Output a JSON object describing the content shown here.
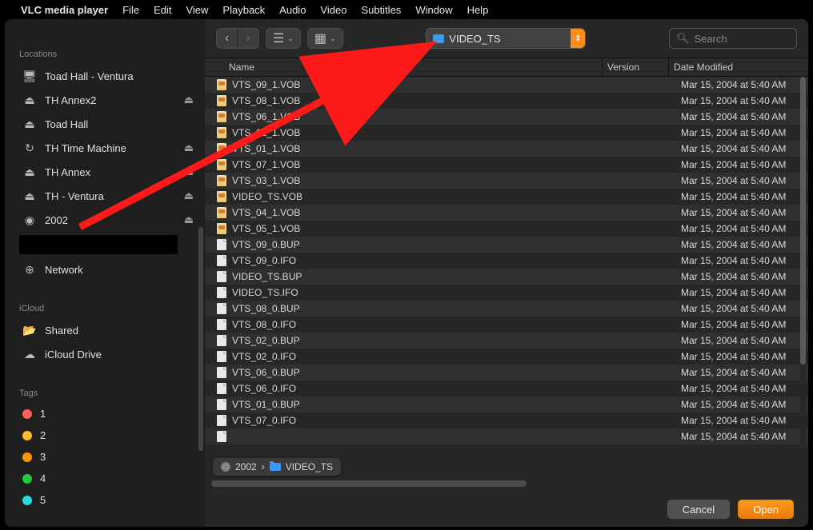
{
  "menubar": {
    "app_name": "VLC media player",
    "items": [
      "File",
      "Edit",
      "View",
      "Playback",
      "Audio",
      "Video",
      "Subtitles",
      "Window",
      "Help"
    ]
  },
  "sidebar": {
    "locations_label": "Locations",
    "icloud_label": "iCloud",
    "tags_label": "Tags",
    "locations": [
      {
        "label": "Toad Hall - Ventura",
        "icon": "display",
        "eject": false
      },
      {
        "label": "TH Annex2",
        "icon": "drive",
        "eject": true
      },
      {
        "label": "Toad Hall",
        "icon": "drive",
        "eject": false
      },
      {
        "label": "TH Time Machine",
        "icon": "timemachine",
        "eject": true
      },
      {
        "label": "TH Annex",
        "icon": "drive",
        "eject": true
      },
      {
        "label": "TH - Ventura",
        "icon": "drive",
        "eject": true
      },
      {
        "label": "2002",
        "icon": "disc",
        "eject": true
      },
      {
        "label": "",
        "icon": "",
        "eject": false,
        "redacted": true
      },
      {
        "label": "Network",
        "icon": "network",
        "eject": false
      }
    ],
    "icloud": [
      {
        "label": "Shared",
        "icon": "folder-shared"
      },
      {
        "label": "iCloud Drive",
        "icon": "cloud"
      }
    ],
    "tags": [
      {
        "label": "1",
        "color": "#ff5f56"
      },
      {
        "label": "2",
        "color": "#ffbd2e"
      },
      {
        "label": "3",
        "color": "#ff9500"
      },
      {
        "label": "4",
        "color": "#27c93f"
      },
      {
        "label": "5",
        "color": "#2dd8e0"
      }
    ]
  },
  "toolbar": {
    "folder_label": "VIDEO_TS",
    "search_placeholder": "Search"
  },
  "columns": {
    "name": "Name",
    "version": "Version",
    "date": "Date Modified"
  },
  "files": [
    {
      "name": "VTS_09_1.VOB",
      "type": "vob",
      "date": "Mar 15, 2004 at 5:40 AM"
    },
    {
      "name": "VTS_08_1.VOB",
      "type": "vob",
      "date": "Mar 15, 2004 at 5:40 AM"
    },
    {
      "name": "VTS_06_1.VOB",
      "type": "vob",
      "date": "Mar 15, 2004 at 5:40 AM"
    },
    {
      "name": "VTS_02_1.VOB",
      "type": "vob",
      "date": "Mar 15, 2004 at 5:40 AM"
    },
    {
      "name": "VTS_01_1.VOB",
      "type": "vob",
      "date": "Mar 15, 2004 at 5:40 AM"
    },
    {
      "name": "VTS_07_1.VOB",
      "type": "vob",
      "date": "Mar 15, 2004 at 5:40 AM"
    },
    {
      "name": "VTS_03_1.VOB",
      "type": "vob",
      "date": "Mar 15, 2004 at 5:40 AM"
    },
    {
      "name": "VIDEO_TS.VOB",
      "type": "vob",
      "date": "Mar 15, 2004 at 5:40 AM"
    },
    {
      "name": "VTS_04_1.VOB",
      "type": "vob",
      "date": "Mar 15, 2004 at 5:40 AM"
    },
    {
      "name": "VTS_05_1.VOB",
      "type": "vob",
      "date": "Mar 15, 2004 at 5:40 AM"
    },
    {
      "name": "VTS_09_0.BUP",
      "type": "doc",
      "date": "Mar 15, 2004 at 5:40 AM"
    },
    {
      "name": "VTS_09_0.IFO",
      "type": "doc",
      "date": "Mar 15, 2004 at 5:40 AM"
    },
    {
      "name": "VIDEO_TS.BUP",
      "type": "doc",
      "date": "Mar 15, 2004 at 5:40 AM"
    },
    {
      "name": "VIDEO_TS.IFO",
      "type": "doc",
      "date": "Mar 15, 2004 at 5:40 AM"
    },
    {
      "name": "VTS_08_0.BUP",
      "type": "doc",
      "date": "Mar 15, 2004 at 5:40 AM"
    },
    {
      "name": "VTS_08_0.IFO",
      "type": "doc",
      "date": "Mar 15, 2004 at 5:40 AM"
    },
    {
      "name": "VTS_02_0.BUP",
      "type": "doc",
      "date": "Mar 15, 2004 at 5:40 AM"
    },
    {
      "name": "VTS_02_0.IFO",
      "type": "doc",
      "date": "Mar 15, 2004 at 5:40 AM"
    },
    {
      "name": "VTS_06_0.BUP",
      "type": "doc",
      "date": "Mar 15, 2004 at 5:40 AM"
    },
    {
      "name": "VTS_06_0.IFO",
      "type": "doc",
      "date": "Mar 15, 2004 at 5:40 AM"
    },
    {
      "name": "VTS_01_0.BUP",
      "type": "doc",
      "date": "Mar 15, 2004 at 5:40 AM"
    },
    {
      "name": "VTS_07_0.IFO",
      "type": "doc",
      "date": "Mar 15, 2004 at 5:40 AM"
    },
    {
      "name": "",
      "type": "doc",
      "date": "Mar 15, 2004 at 5:40 AM"
    }
  ],
  "pathbar": {
    "item1": "2002",
    "item2": "VIDEO_TS"
  },
  "buttons": {
    "cancel": "Cancel",
    "open": "Open"
  }
}
